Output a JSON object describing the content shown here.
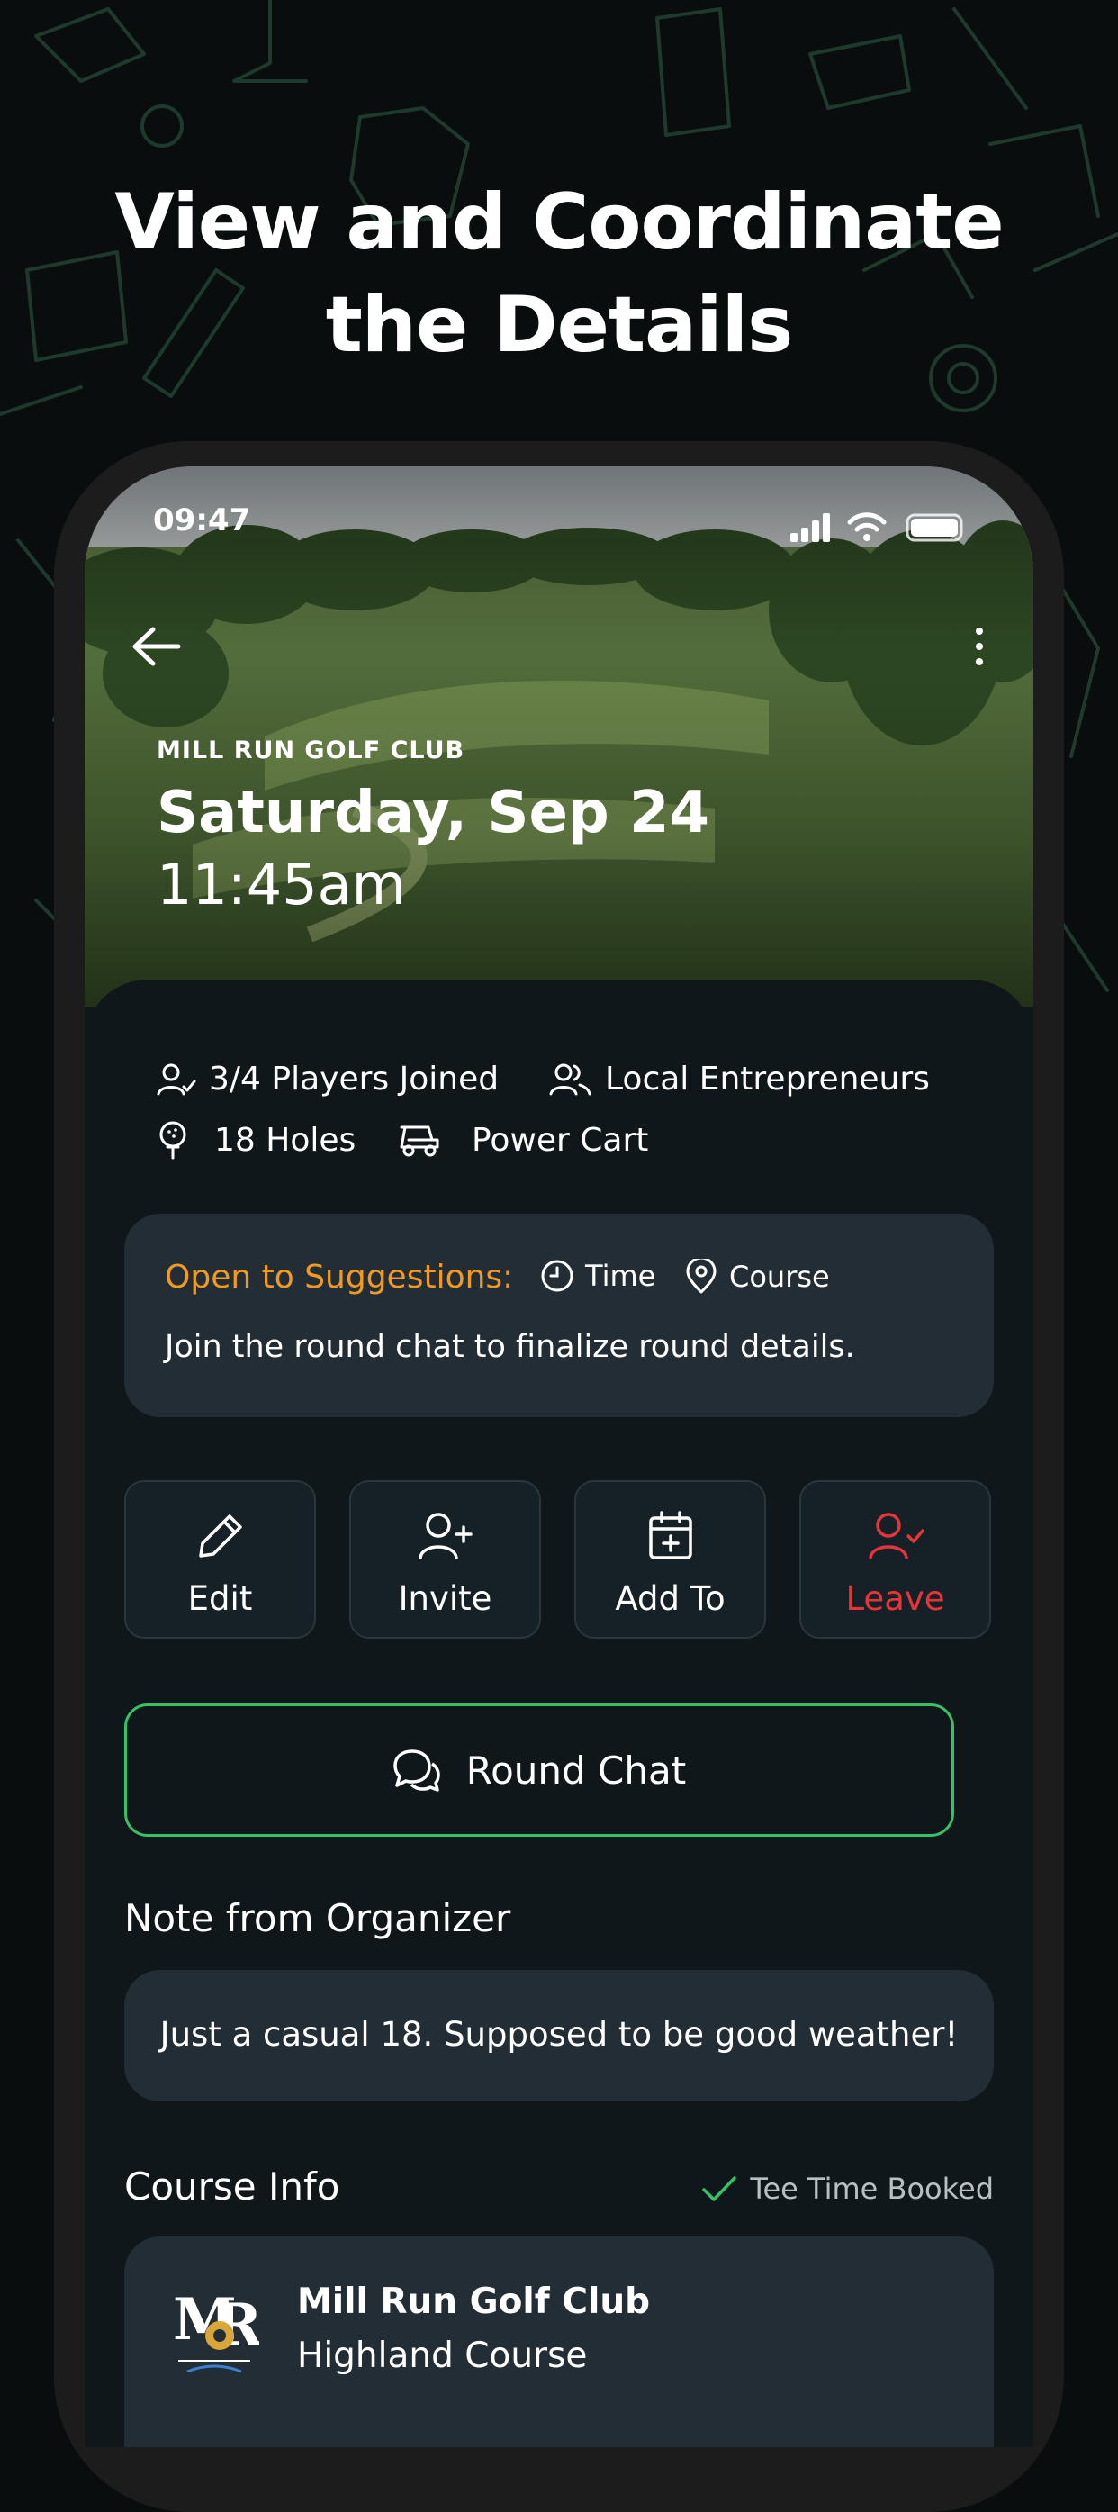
{
  "headline": {
    "line1": "View and Coordinate",
    "line2": "the Details"
  },
  "status_bar": {
    "time": "09:47"
  },
  "round": {
    "club": "MILL RUN GOLF CLUB",
    "date": "Saturday, Sep 24",
    "time": "11:45am"
  },
  "meta": {
    "players": "3/4 Players Joined",
    "group": "Local Entrepreneurs",
    "holes": "18 Holes",
    "cart": "Power Cart"
  },
  "suggestions": {
    "title": "Open to Suggestions:",
    "tags": [
      "Time",
      "Course"
    ],
    "text": "Join the round chat to finalize round details."
  },
  "actions": [
    {
      "label": "Edit",
      "icon": "pencil-icon"
    },
    {
      "label": "Invite",
      "icon": "user-plus-icon"
    },
    {
      "label": "Add To",
      "icon": "calendar-plus-icon"
    },
    {
      "label": "Leave",
      "icon": "user-check-icon"
    }
  ],
  "chat_button": {
    "label": "Round Chat"
  },
  "note": {
    "title": "Note from Organizer",
    "text": "Just a casual 18. Supposed to be good weather!"
  },
  "course_info": {
    "title": "Course Info",
    "status": "Tee Time Booked",
    "name": "Mill Run Golf Club",
    "course": "Highland Course"
  },
  "colors": {
    "accent_orange": "#f39a1e",
    "accent_green": "#35c165",
    "danger_red": "#e5343a",
    "card_bg": "#232d35",
    "sheet_bg": "#0f171b"
  }
}
